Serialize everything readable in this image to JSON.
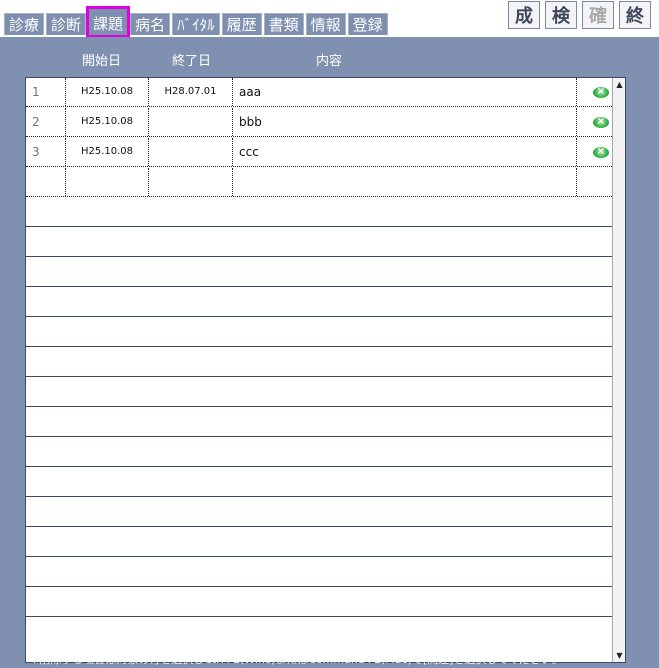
{
  "tabs": [
    {
      "label": "診療",
      "active": false
    },
    {
      "label": "診断",
      "active": false
    },
    {
      "label": "課題",
      "active": true
    },
    {
      "label": "病名",
      "active": false
    },
    {
      "label": "ﾊﾞｲﾀﾙ",
      "active": false
    },
    {
      "label": "履歴",
      "active": false
    },
    {
      "label": "書類",
      "active": false
    },
    {
      "label": "情報",
      "active": false
    },
    {
      "label": "登録",
      "active": false
    }
  ],
  "actions": [
    {
      "label": "成",
      "enabled": true
    },
    {
      "label": "検",
      "enabled": true
    },
    {
      "label": "確",
      "enabled": false
    },
    {
      "label": "終",
      "enabled": true
    }
  ],
  "columns": {
    "start": "開始日",
    "end": "終了日",
    "content": "内容"
  },
  "rows": [
    {
      "num": "1",
      "start": "H25.10.08",
      "end": "H28.07.01",
      "content": "aaa"
    },
    {
      "num": "2",
      "start": "H25.10.08",
      "end": "",
      "content": "bbb"
    },
    {
      "num": "3",
      "start": "H25.10.08",
      "end": "",
      "content": "ccc"
    }
  ],
  "icons": {
    "row_remove": "remove-x-circle-icon"
  },
  "colors": {
    "panel": "#8090b0",
    "highlight": "#e000e0",
    "remove_icon": "#36b04a"
  },
  "footer": "※削除する場合は対象の行を選択しCtrl+E(Winc)またはCommand+E(Mac)で[関連]を選択してください。"
}
